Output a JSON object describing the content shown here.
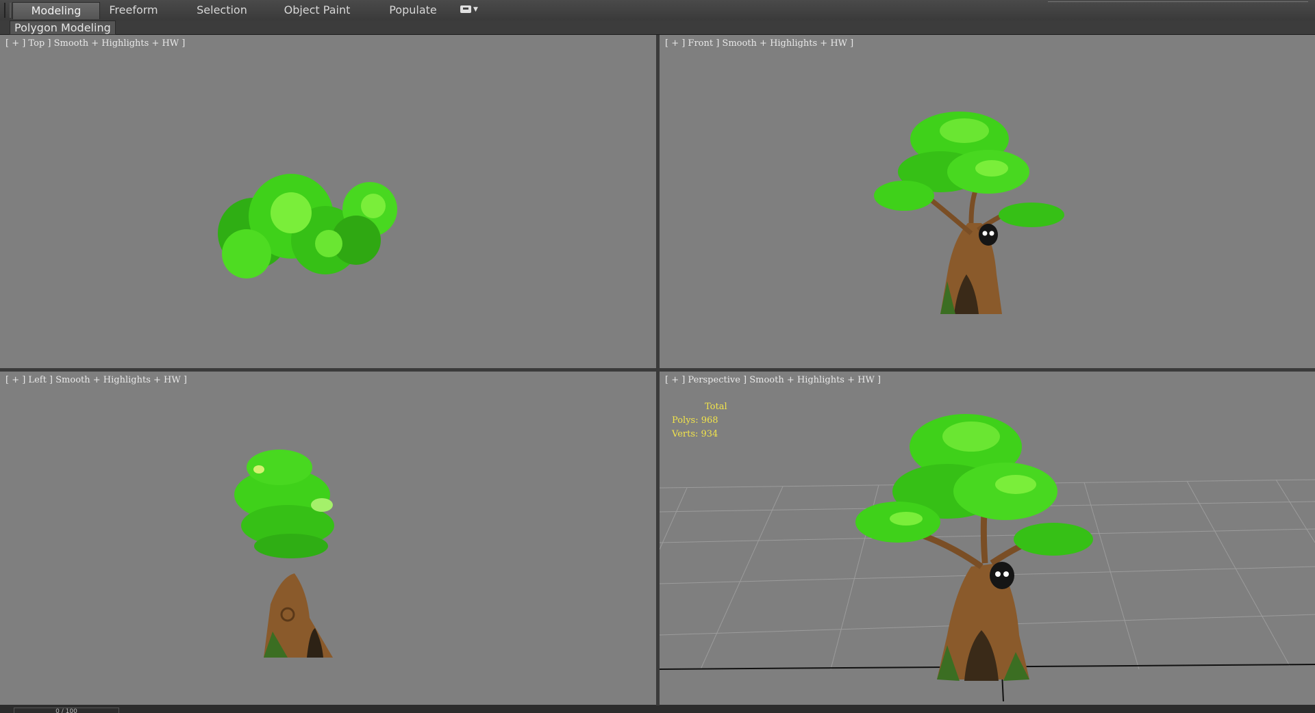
{
  "ribbon": {
    "tabs": [
      "Modeling",
      "Freeform",
      "Selection",
      "Object Paint",
      "Populate"
    ],
    "active_tab": "Modeling",
    "more_icon": "dropdown-toggle-icon"
  },
  "subpanel": {
    "label": "Polygon Modeling"
  },
  "viewports": {
    "top": {
      "label": "[ + ] Top ] Smooth + Highlights + HW ]"
    },
    "front": {
      "label": "[ + ] Front ] Smooth + Highlights + HW ]"
    },
    "left": {
      "label": "[ + ] Left ] Smooth + Highlights + HW ]"
    },
    "persp": {
      "label": "[ + ] Perspective ] Smooth + Highlights + HW ]",
      "stats": {
        "title": "Total",
        "polys": "Polys: 968",
        "verts": "Verts: 934"
      }
    }
  },
  "timeline": {
    "frame": "0 / 100"
  },
  "colors": {
    "viewport_bg": "#7f7f7f",
    "stats_text": "#f2e44b",
    "foliage": "#3fd11a",
    "trunk": "#8a5a2b"
  }
}
